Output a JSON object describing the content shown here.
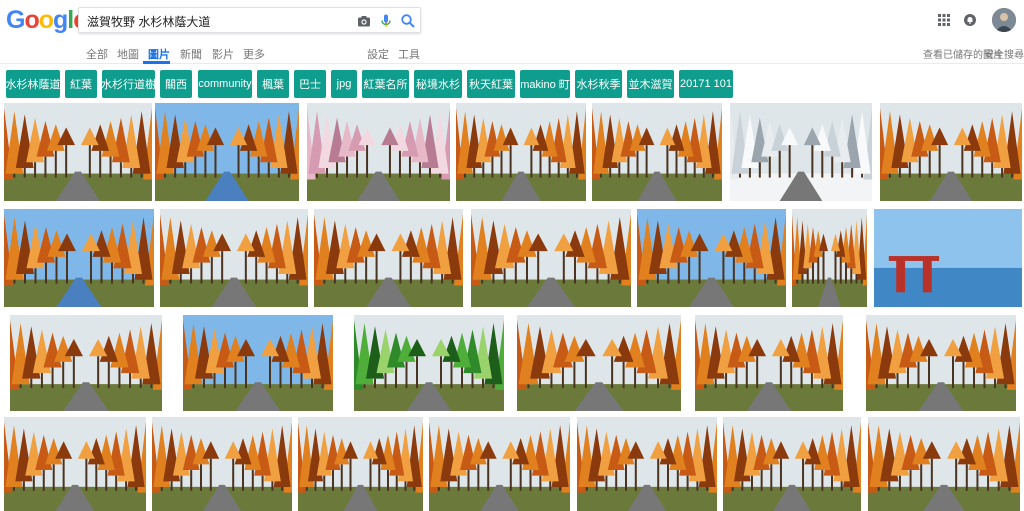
{
  "logo": {
    "letters": [
      "G",
      "o",
      "o",
      "g",
      "l",
      "e"
    ],
    "colors": [
      "#4285f4",
      "#ea4335",
      "#fbbc05",
      "#4285f4",
      "#34a853",
      "#ea4335"
    ]
  },
  "search": {
    "query": "滋賀牧野 水杉林蔭大道"
  },
  "icons": {
    "camera": "camera-icon",
    "mic": "mic-icon",
    "search": "search-icon",
    "apps": "apps-grid-icon",
    "notifications": "notifications-icon"
  },
  "tabs": {
    "all": "全部",
    "maps": "地圖",
    "images": "圖片",
    "news": "新聞",
    "videos": "影片",
    "more": "更多",
    "settings": "設定",
    "tools": "工具",
    "saved_images": "查看已儲存的圖片",
    "safe_search": "安全搜尋 ▾"
  },
  "chips": [
    "水杉林蔭道",
    "紅葉",
    "水杉行道樹",
    "關西",
    "community",
    "楓葉",
    "巴士",
    "jpg",
    "紅葉名所",
    "秘境水杉",
    "秋天紅葉",
    "makino 町",
    "水杉秋季",
    "並木滋賀",
    "20171 101"
  ],
  "accent_colors": {
    "chip_bg": "#0f9d8e",
    "active_tab": "#1a73e8"
  },
  "thumbnails": {
    "row1": [
      "orange-avenue",
      "avenue-with-blue-road",
      "cherry-blossom-avenue",
      "avenue-with-sign",
      "orange-avenue-dusk",
      "snowy-avenue",
      "curved-orange-road"
    ],
    "row2": [
      "orange-trees-blue-sky",
      "tall-trees-curve",
      "dense-orange-avenue",
      "avenue-with-car",
      "tall-trees-sky",
      "narrow-orange-path",
      "torii-in-lake"
    ],
    "row3": [
      "tunnel-orange",
      "trees-white-sky",
      "green-avenue",
      "motorcycle-on-road",
      "watermarked-avenue",
      "sunny-orange-avenue"
    ],
    "row4": [
      "bare-trees",
      "orange-field",
      "road-to-hills",
      "orange-tunnel-dim",
      "orange-corridor",
      "dense-orange-forest",
      "dark-avenue-cars"
    ]
  }
}
